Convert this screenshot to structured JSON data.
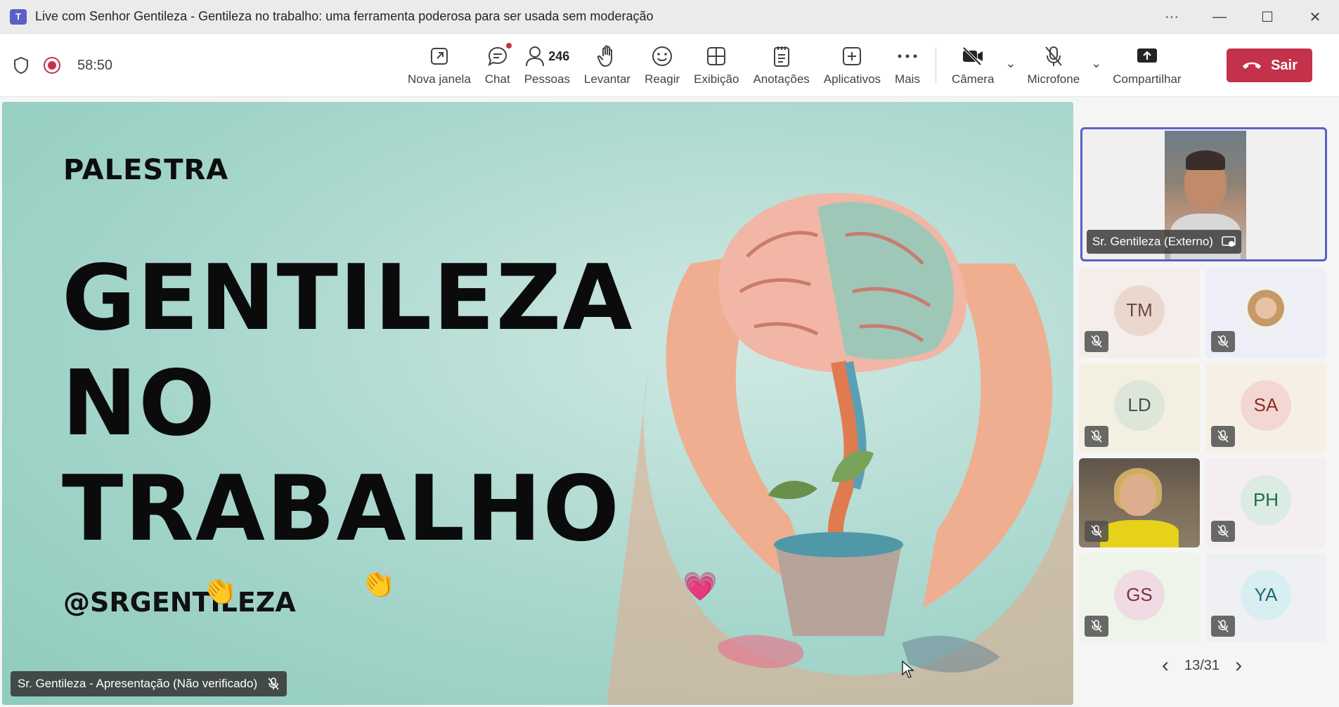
{
  "window": {
    "title": "Live com Senhor Gentileza - Gentileza no trabalho: uma ferramenta poderosa para ser usada sem moderação",
    "controls": {
      "more": "···",
      "minimize": "—",
      "maximize": "☐",
      "close": "✕"
    }
  },
  "meeting": {
    "timer": "58:50"
  },
  "toolbar": {
    "new_window": "Nova janela",
    "chat": "Chat",
    "people": "Pessoas",
    "people_count": "246",
    "raise": "Levantar",
    "react": "Reagir",
    "view": "Exibição",
    "notes": "Anotações",
    "apps": "Aplicativos",
    "more": "Mais",
    "camera": "Câmera",
    "mic": "Microfone",
    "share": "Compartilhar",
    "leave": "Sair"
  },
  "slide": {
    "kicker": "PALESTRA",
    "title_lines": [
      "GENTILEZA",
      "NO",
      "TRABALHO"
    ],
    "handle": "@SRGENTILEZA"
  },
  "presenter_label": "Sr. Gentileza - Apresentação (Não verificado)",
  "featured": {
    "name": "Sr. Gentileza (Externo)"
  },
  "participants": [
    {
      "initials": "TM",
      "bg": "#f5ede9",
      "avatar_bg": "#ead8cf",
      "fg": "#6b4a3a"
    },
    {
      "initials": "",
      "bg": "#eeeef8",
      "avatar_bg": "#e2d6c8",
      "fg": "#333"
    },
    {
      "initials": "LD",
      "bg": "#f3f0e2",
      "avatar_bg": "#dde6d8",
      "fg": "#3c5a4a"
    },
    {
      "initials": "SA",
      "bg": "#f6efe6",
      "avatar_bg": "#f3d7d3",
      "fg": "#8a2e23"
    },
    {
      "initials": "",
      "bg": "#6a5a4a",
      "avatar_bg": "",
      "fg": ""
    },
    {
      "initials": "PH",
      "bg": "#f5eef0",
      "avatar_bg": "#dcebe3",
      "fg": "#1f6b4a"
    },
    {
      "initials": "GS",
      "bg": "#eef4ea",
      "avatar_bg": "#f0dbe3",
      "fg": "#7a2f4a"
    },
    {
      "initials": "YA",
      "bg": "#eef0f4",
      "avatar_bg": "#d8eef0",
      "fg": "#1f6a78"
    }
  ],
  "pager": {
    "label": "13/31",
    "prev": "‹",
    "next": "›"
  },
  "colors": {
    "accent": "#5b5fc7",
    "leave": "#c4314b"
  }
}
